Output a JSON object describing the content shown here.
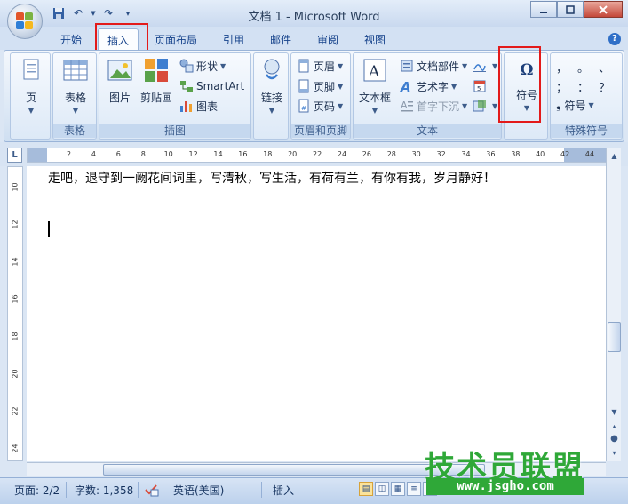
{
  "window": {
    "title": "文档 1 - Microsoft Word"
  },
  "quick_access": {
    "icons": [
      "save-icon",
      "undo-icon",
      "redo-icon",
      "customize-icon"
    ]
  },
  "tabs": [
    {
      "label": "开始",
      "active": false
    },
    {
      "label": "插入",
      "active": true
    },
    {
      "label": "页面布局",
      "active": false
    },
    {
      "label": "引用",
      "active": false
    },
    {
      "label": "邮件",
      "active": false
    },
    {
      "label": "审阅",
      "active": false
    },
    {
      "label": "视图",
      "active": false
    }
  ],
  "ribbon": {
    "pages": {
      "label": "页"
    },
    "tables": {
      "label": "表格",
      "group": "表格"
    },
    "illustrations": {
      "picture": "图片",
      "clipart": "剪贴画",
      "shapes": "形状",
      "smartart": "SmartArt",
      "chart": "图表",
      "group": "插图"
    },
    "links": {
      "label": "链接"
    },
    "header_footer": {
      "header": "页眉",
      "footer": "页脚",
      "page_number": "页码",
      "group": "页眉和页脚"
    },
    "text": {
      "textbox": "文本框",
      "quickparts": "文档部件",
      "wordart": "艺术字",
      "dropcap": "首字下沉",
      "group": "文本"
    },
    "symbols": {
      "symbol": "符号",
      "omega": "Ω"
    },
    "special": {
      "row1": [
        "，",
        "。",
        "、"
      ],
      "row2": [
        "；",
        "：",
        "？"
      ],
      "symbol_btn": "符号",
      "group": "特殊符号"
    }
  },
  "ruler": {
    "h_ticks": [
      "2",
      "4",
      "6",
      "8",
      "10",
      "12",
      "14",
      "16",
      "18",
      "20",
      "22",
      "24",
      "26",
      "28",
      "30",
      "32",
      "34",
      "36",
      "38",
      "40",
      "42",
      "44"
    ],
    "v_ticks": [
      "10",
      "12",
      "14",
      "16",
      "18",
      "20",
      "22",
      "24"
    ],
    "corner": "L"
  },
  "document": {
    "line1": "走吧，退守到一阙花间词里，写清秋，写生活，有荷有兰，有你有我，岁月静好！"
  },
  "statusbar": {
    "page": "页面: 2/2",
    "words": "字数: 1,358",
    "language": "英语(美国)",
    "mode": "插入"
  },
  "watermark": {
    "brand": "技术员联盟",
    "url": "www.jsgho.com"
  }
}
